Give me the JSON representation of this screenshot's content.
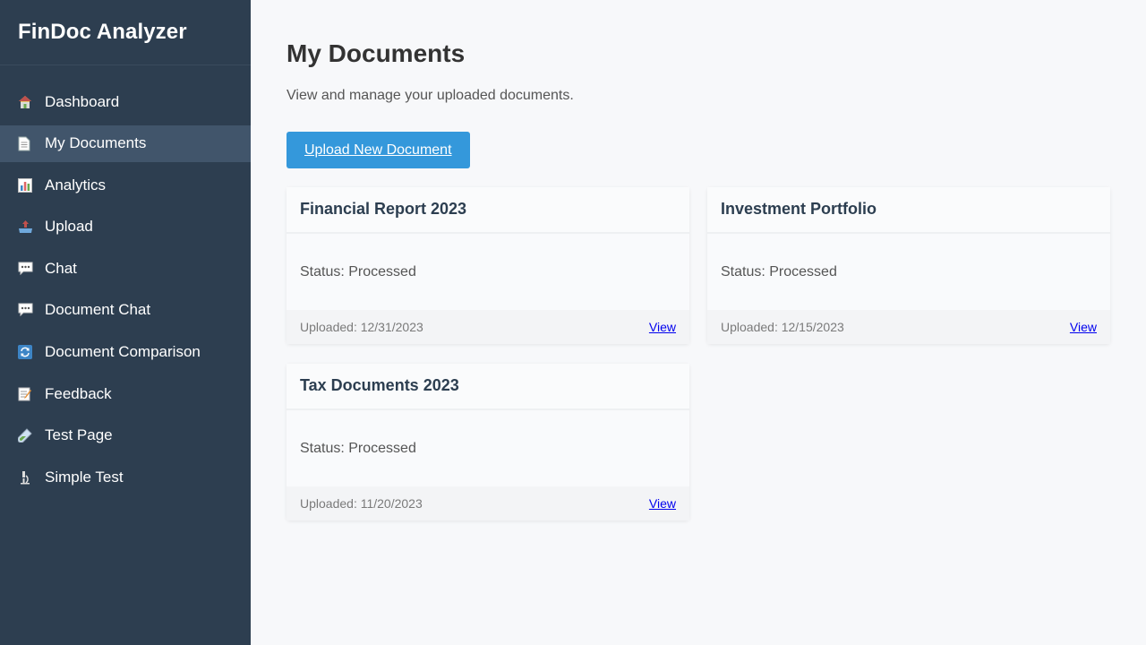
{
  "app": {
    "title": "FinDoc Analyzer"
  },
  "sidebar": {
    "items": [
      {
        "label": "Dashboard",
        "icon": "house-icon",
        "active": false
      },
      {
        "label": "My Documents",
        "icon": "document-icon",
        "active": true
      },
      {
        "label": "Analytics",
        "icon": "bar-chart-icon",
        "active": false
      },
      {
        "label": "Upload",
        "icon": "upload-tray-icon",
        "active": false
      },
      {
        "label": "Chat",
        "icon": "speech-bubble-icon",
        "active": false
      },
      {
        "label": "Document Chat",
        "icon": "speech-bubble-icon",
        "active": false
      },
      {
        "label": "Document Comparison",
        "icon": "refresh-icon",
        "active": false
      },
      {
        "label": "Feedback",
        "icon": "memo-icon",
        "active": false
      },
      {
        "label": "Test Page",
        "icon": "test-tube-icon",
        "active": false
      },
      {
        "label": "Simple Test",
        "icon": "microscope-icon",
        "active": false
      }
    ]
  },
  "main": {
    "title": "My Documents",
    "subtitle": "View and manage your uploaded documents.",
    "upload_label": "Upload New Document"
  },
  "documents": [
    {
      "title": "Financial Report 2023",
      "status": "Status: Processed",
      "uploaded": "Uploaded: 12/31/2023",
      "action": "View"
    },
    {
      "title": "Investment Portfolio",
      "status": "Status: Processed",
      "uploaded": "Uploaded: 12/15/2023",
      "action": "View"
    },
    {
      "title": "Tax Documents 2023",
      "status": "Status: Processed",
      "uploaded": "Uploaded: 11/20/2023",
      "action": "View"
    }
  ],
  "colors": {
    "sidebar_bg": "#2d3e50",
    "sidebar_active": "#41556b",
    "accent": "#3498db",
    "link": "#0000ee"
  }
}
